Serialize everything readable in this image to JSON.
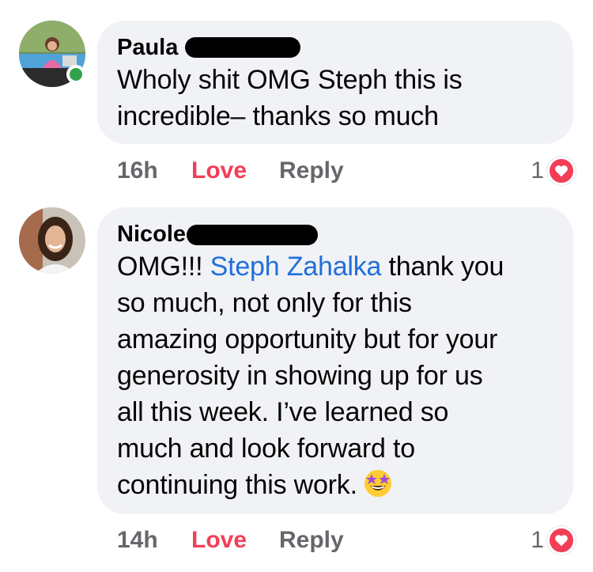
{
  "comments": [
    {
      "author": "Paula",
      "lines": [
        "Wholy shit OMG Steph this is",
        "incredible– thanks so much"
      ],
      "time": "16h",
      "love_label": "Love",
      "reply_label": "Reply",
      "reaction_count": "1",
      "online": true
    },
    {
      "author": "Nicole",
      "text_prefix": "OMG!!! ",
      "mention": "Steph Zahalka",
      "text_after_mention": " thank you",
      "lines": [
        "so much, not only for this",
        "amazing opportunity but for your",
        "generosity in showing up for us",
        "all this week. I’ve learned so",
        "much and look forward to",
        "continuing this work."
      ],
      "time": "14h",
      "love_label": "Love",
      "reply_label": "Reply",
      "reaction_count": "1",
      "online": false
    }
  ],
  "icons": {
    "reaction": "heart-icon",
    "emoji": "star-struck-emoji-icon"
  },
  "colors": {
    "bubble": "#f0f2f5",
    "mention": "#216fdb",
    "love": "#f33e58",
    "online": "#31a24c",
    "meta": "#65676b"
  }
}
